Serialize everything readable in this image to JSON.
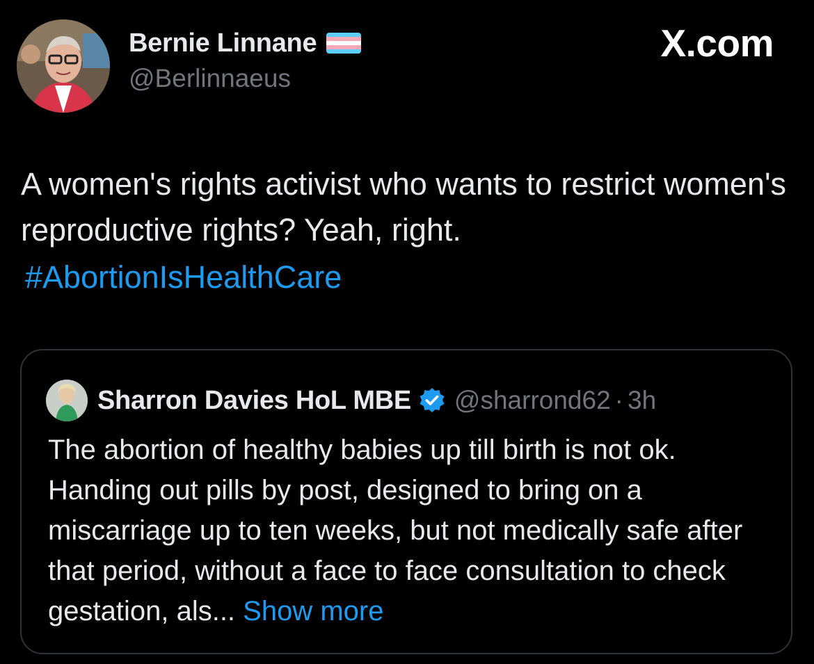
{
  "tweet": {
    "author": {
      "display_name": "Bernie Linnane",
      "handle": "@Berlinnaeus",
      "flag_icon": "transgender-flag-icon"
    },
    "brand": "X.com",
    "text": "A women's rights activist who wants to restrict women's reproductive rights? Yeah, right.",
    "hashtag": "#AbortionIsHealthCare"
  },
  "quote": {
    "author": {
      "display_name": "Sharron Davies HoL MBE",
      "handle": "@sharrond62",
      "separator": "·",
      "time": "3h",
      "verified_icon": "verified-badge-icon"
    },
    "text": "The abortion of healthy babies up till birth is not ok. Handing out pills by post, designed to bring on a miscarriage up to ten weeks, but not medically safe after that period, without a face to face consultation to check gestation, als...",
    "show_more": "Show more"
  },
  "colors": {
    "background": "#000000",
    "text_primary": "#e7e9ea",
    "text_secondary": "#71767b",
    "accent": "#1d9bf0",
    "border": "#2f3336",
    "flag_blue": "#5bcefa",
    "flag_pink": "#f5a9b8",
    "flag_white": "#ffffff"
  }
}
